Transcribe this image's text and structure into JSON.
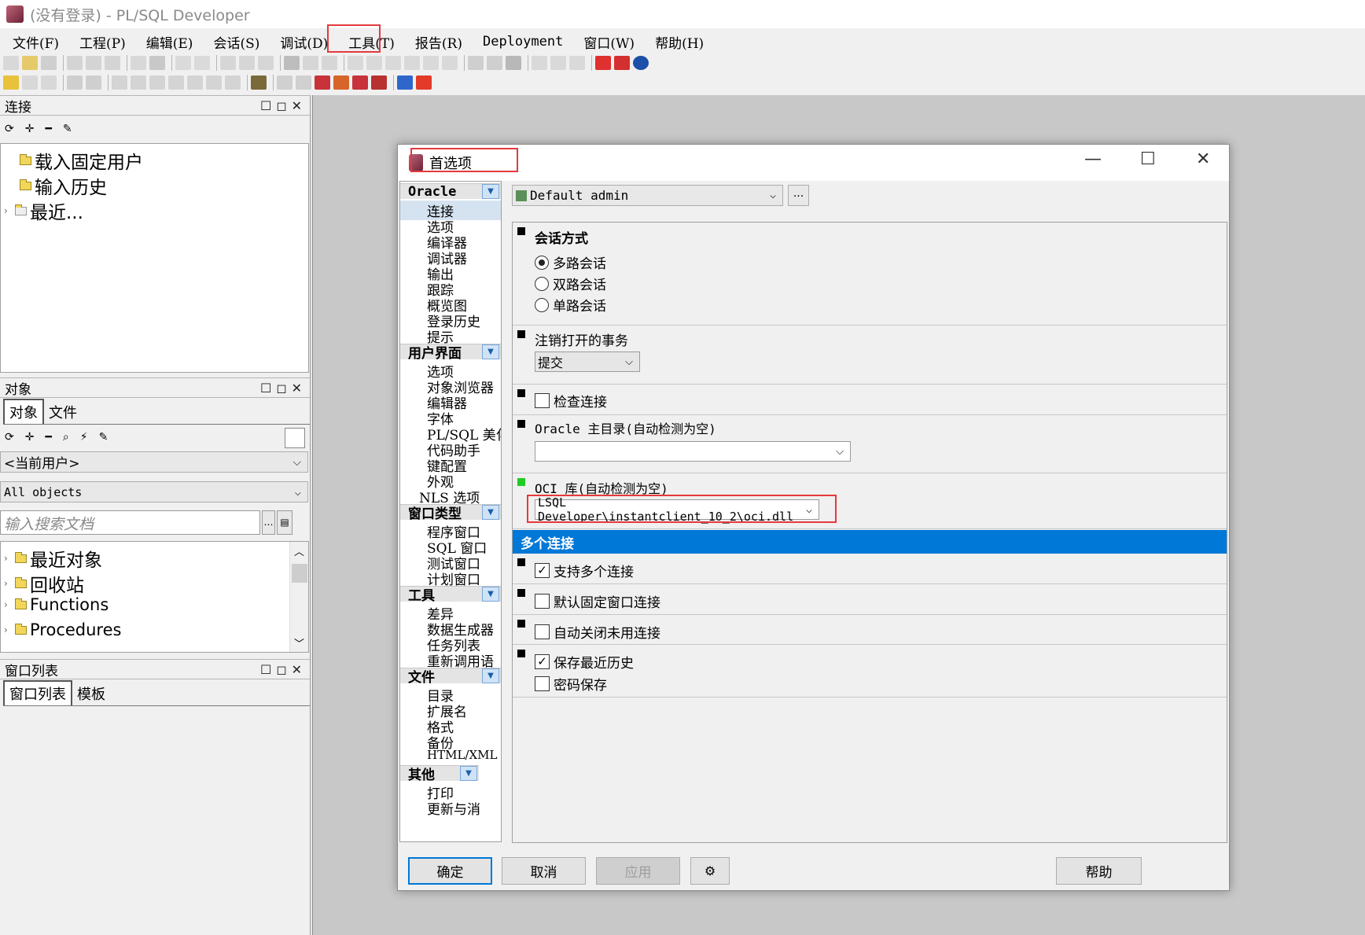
{
  "window": {
    "title": "(没有登录) - PL/SQL Developer"
  },
  "menu": [
    "文件(F)",
    "工程(P)",
    "编辑(E)",
    "会话(S)",
    "调试(D)",
    "工具(T)",
    "报告(R)",
    "Deployment",
    "窗口(W)",
    "帮助(H)"
  ],
  "left": {
    "connection_pane": {
      "title": "连接",
      "items": [
        "载入固定用户",
        "输入历史",
        "最近..."
      ]
    },
    "object_pane": {
      "title": "对象",
      "tabs": [
        "对象",
        "文件"
      ],
      "user_select": "<当前用户>",
      "objects_select": "All objects",
      "search_placeholder": "输入搜索文档",
      "items": [
        "最近对象",
        "回收站",
        "Functions",
        "Procedures"
      ]
    },
    "window_list_pane": {
      "title": "窗口列表",
      "tabs": [
        "窗口列表",
        "模板"
      ]
    }
  },
  "dialog": {
    "title": "首选项",
    "profile": "Default admin",
    "profile_button": "...",
    "nav": [
      {
        "header": "Oracle",
        "items": [
          "连接",
          "选项",
          "编译器",
          "调试器",
          "输出",
          "跟踪",
          "概览图",
          "登录历史",
          "提示"
        ]
      },
      {
        "header": "用户界面",
        "items": [
          "选项",
          "对象浏览器",
          "编辑器",
          "字体",
          "PL/SQL 美化",
          "代码助手",
          "键配置",
          "外观",
          "NLS 选项"
        ]
      },
      {
        "header": "窗口类型",
        "items": [
          "程序窗口",
          "SQL 窗口",
          "测试窗口",
          "计划窗口"
        ]
      },
      {
        "header": "工具",
        "items": [
          "差异",
          "数据生成器",
          "任务列表",
          "重新调用语"
        ]
      },
      {
        "header": "文件",
        "items": [
          "目录",
          "扩展名",
          "格式",
          "备份",
          "HTML/XML"
        ]
      },
      {
        "header": "其他",
        "items": [
          "打印",
          "更新与消"
        ]
      }
    ],
    "session_mode": {
      "label": "会话方式",
      "options": [
        "多路会话",
        "双路会话",
        "单路会话"
      ],
      "selected": "多路会话"
    },
    "logoff_label": "注销打开的事务",
    "logoff_value": "提交",
    "check_connection": {
      "label": "检查连接",
      "checked": false
    },
    "oracle_home_label": "Oracle 主目录(自动检测为空)",
    "oracle_home_value": "",
    "oci_label": "OCI 库(自动检测为空)",
    "oci_value": "LSQL Developer\\instantclient_10_2\\oci.dll",
    "multi_section": "多个连接",
    "multi_options": [
      {
        "label": "支持多个连接",
        "checked": true
      },
      {
        "label": "默认固定窗口连接",
        "checked": false
      },
      {
        "label": "自动关闭未用连接",
        "checked": false
      },
      {
        "label": "保存最近历史",
        "checked": true
      },
      {
        "label": "密码保存",
        "checked": false
      }
    ],
    "buttons": {
      "ok": "确定",
      "cancel": "取消",
      "apply": "应用",
      "help": "帮助"
    }
  },
  "colors": {
    "highlight_box": "#e5393c",
    "section_band": "#0078d7",
    "marker_green": "#22cc22"
  }
}
